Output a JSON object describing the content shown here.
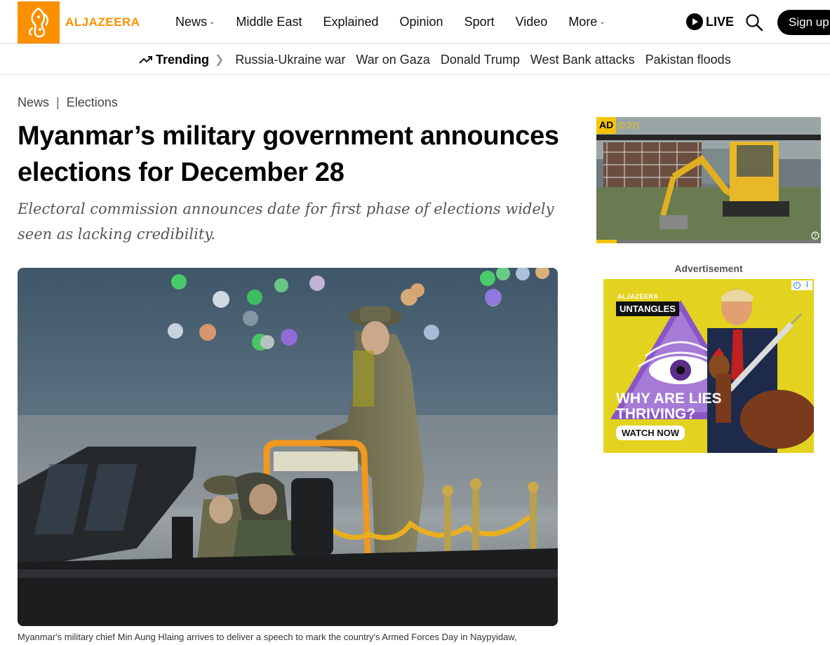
{
  "header": {
    "logo_text": "ALJAZEERA",
    "nav": [
      {
        "label": "News",
        "dropdown": true
      },
      {
        "label": "Middle East",
        "dropdown": false
      },
      {
        "label": "Explained",
        "dropdown": false
      },
      {
        "label": "Opinion",
        "dropdown": false
      },
      {
        "label": "Sport",
        "dropdown": false
      },
      {
        "label": "Video",
        "dropdown": false
      },
      {
        "label": "More",
        "dropdown": true
      }
    ],
    "live_label": "LIVE",
    "signup_label": "Sign up"
  },
  "trending": {
    "label": "Trending",
    "links": [
      "Russia-Ukraine war",
      "War on Gaza",
      "Donald Trump",
      "West Bank attacks",
      "Pakistan floods"
    ]
  },
  "article": {
    "breadcrumb": [
      "News",
      "Elections"
    ],
    "headline": "Myanmar’s military government announces elections for December 28",
    "subhead": "Electoral commission announces date for first phase of elections widely seen as lacking credibility.",
    "caption": "Myanmar's military chief Min Aung Hlaing arrives to deliver a speech to mark the country's Armed Forces Day in Naypyidaw,"
  },
  "video_ad": {
    "badge": "AD",
    "time": "(0:27)",
    "progress": 0.09
  },
  "advertisement_label": "Advertisement",
  "promo_ad": {
    "brand": "ALJAZEERA",
    "tag": "UNTANGLES",
    "headline_line1": "WHY ARE LIES",
    "headline_line2": "THRIVING?",
    "cta": "WATCH NOW"
  },
  "colors": {
    "brand_orange": "#fa9000",
    "ad_yellow": "#f5c400",
    "promo_bg": "#e3d21f"
  }
}
